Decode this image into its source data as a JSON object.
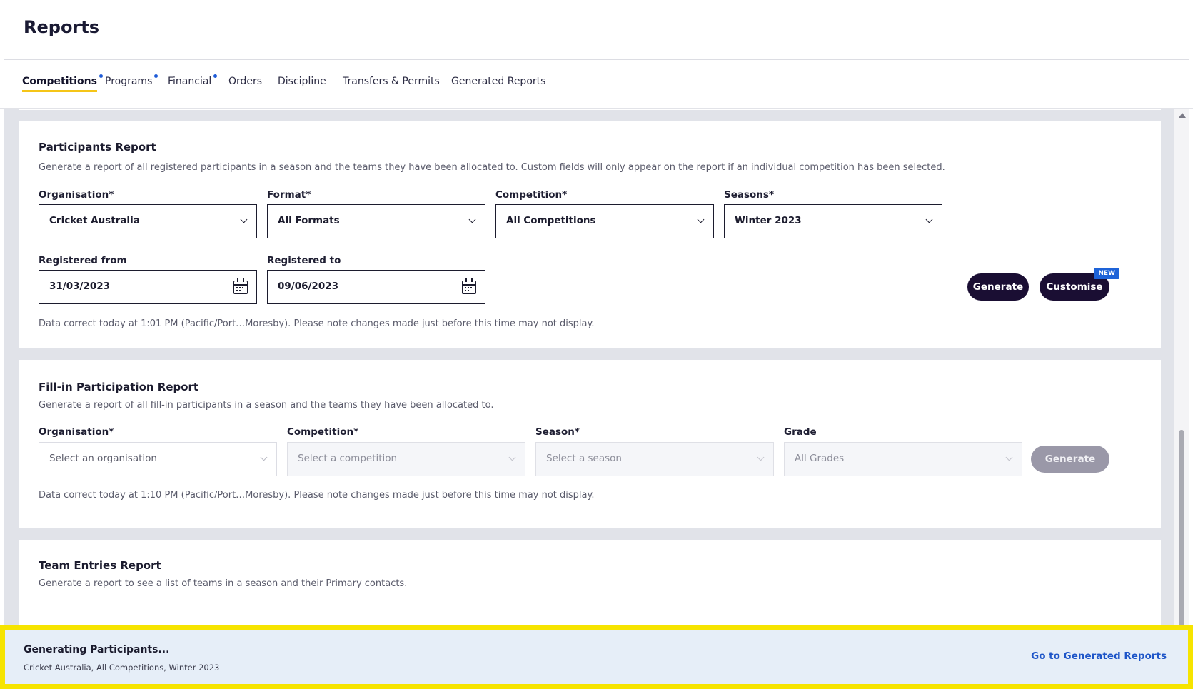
{
  "header": {
    "title": "Reports"
  },
  "tabs": [
    {
      "label": "Competitions",
      "active": true,
      "dot": true
    },
    {
      "label": "Programs",
      "dot": true
    },
    {
      "label": "Financial",
      "dot": true
    },
    {
      "label": "Orders"
    },
    {
      "label": "Discipline"
    },
    {
      "label": "Transfers & Permits"
    },
    {
      "label": "Generated Reports"
    }
  ],
  "participants": {
    "title": "Participants Report",
    "description": "Generate a report of all registered participants in a season and the teams they have been allocated to. Custom fields will only appear on the report if an individual competition has been selected.",
    "organisation": {
      "label": "Organisation*",
      "value": "Cricket Australia"
    },
    "format": {
      "label": "Format*",
      "value": "All Formats"
    },
    "competition": {
      "label": "Competition*",
      "value": "All Competitions"
    },
    "seasons": {
      "label": "Seasons*",
      "value": "Winter 2023"
    },
    "registered_from": {
      "label": "Registered from",
      "value": "31/03/2023"
    },
    "registered_to": {
      "label": "Registered to",
      "value": "09/06/2023"
    },
    "generate_label": "Generate",
    "customise_label": "Customise",
    "new_badge": "NEW",
    "note": "Data correct today at 1:01 PM (Pacific/Port…Moresby). Please note changes made just before this time may not display."
  },
  "fillin": {
    "title": "Fill-in Participation Report",
    "description": "Generate a report of all fill-in participants in a season and the teams they have been allocated to.",
    "organisation": {
      "label": "Organisation*",
      "placeholder": "Select an organisation"
    },
    "competition": {
      "label": "Competition*",
      "placeholder": "Select a competition"
    },
    "season": {
      "label": "Season*",
      "placeholder": "Select a season"
    },
    "grade": {
      "label": "Grade",
      "placeholder": "All Grades"
    },
    "generate_label": "Generate",
    "note": "Data correct today at 1:10 PM (Pacific/Port…Moresby). Please note changes made just before this time may not display."
  },
  "team_entries": {
    "title": "Team Entries Report",
    "description": "Generate a report to see a list of teams in a season and their Primary contacts."
  },
  "toast": {
    "title": "Generating Participants...",
    "subtitle": "Cricket Australia, All Competitions, Winter 2023",
    "link": "Go to Generated Reports"
  },
  "colors": {
    "accent_dark": "#1a0e33",
    "tab_underline": "#f5c518",
    "link_blue": "#1e55c8",
    "highlight": "#f6e400"
  }
}
